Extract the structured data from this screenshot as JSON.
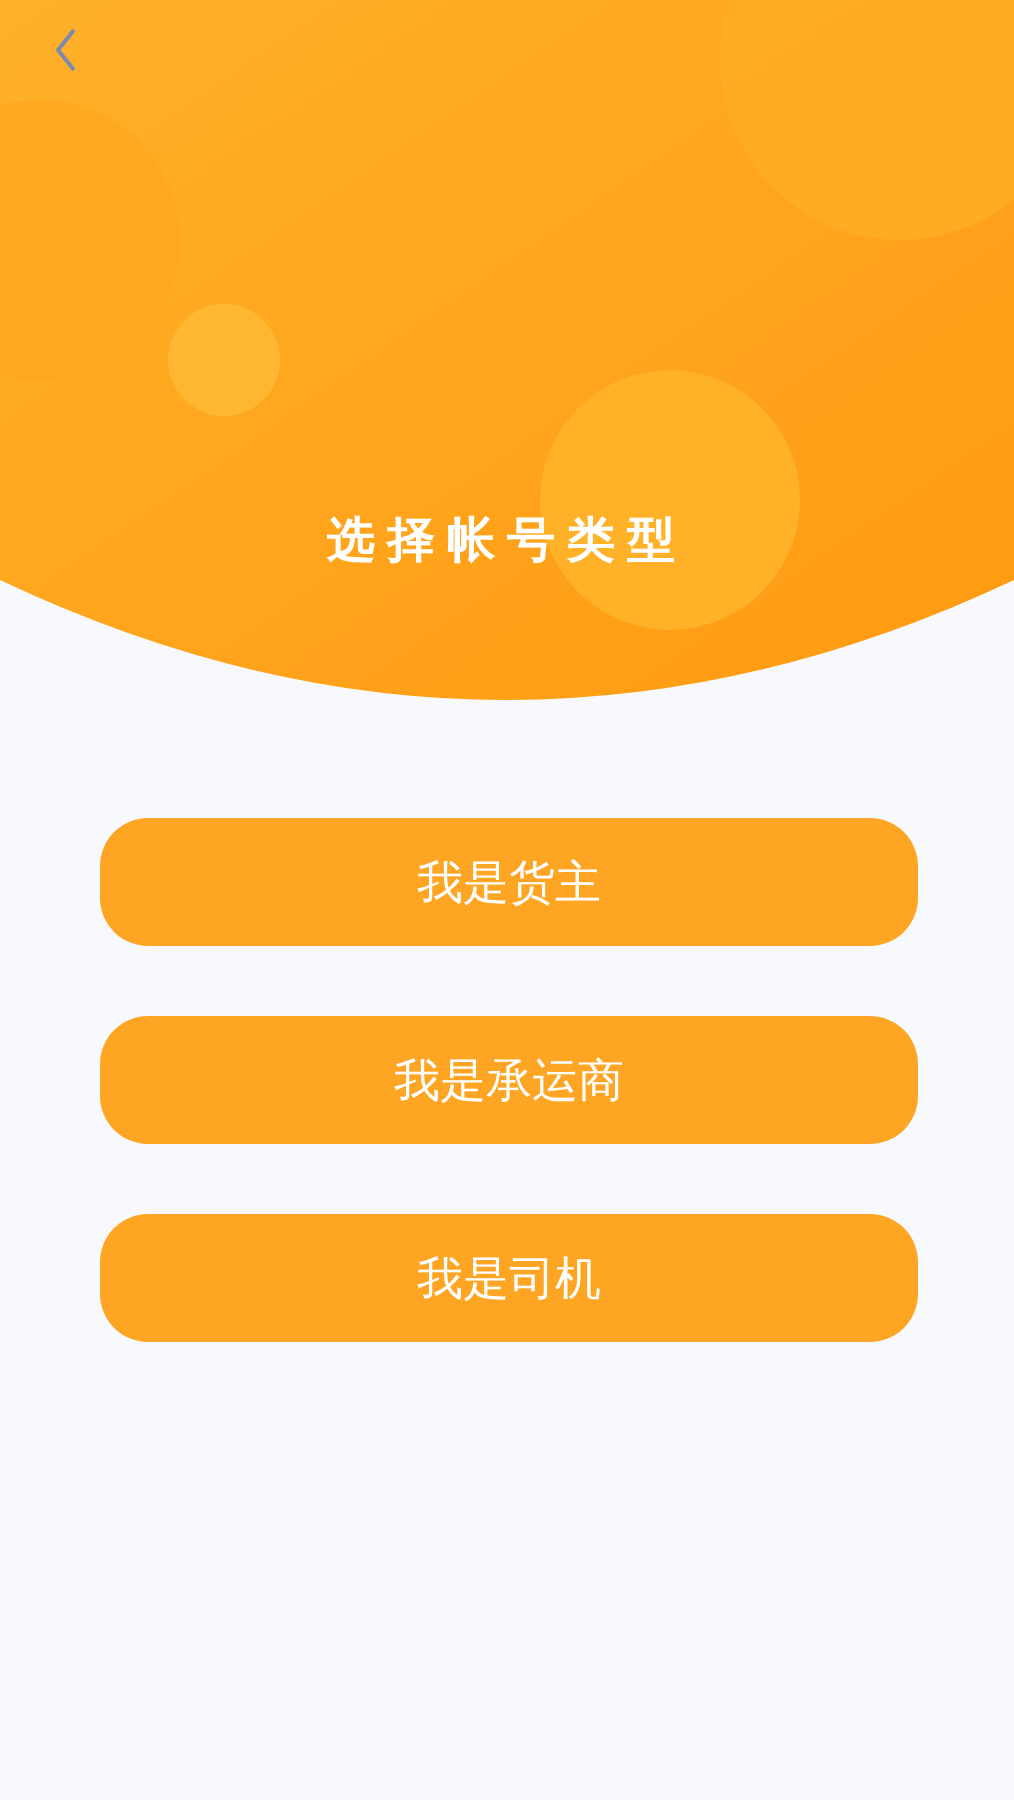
{
  "header": {
    "title": "选择帐号类型"
  },
  "options": [
    "我是货主",
    "我是承运商",
    "我是司机"
  ]
}
